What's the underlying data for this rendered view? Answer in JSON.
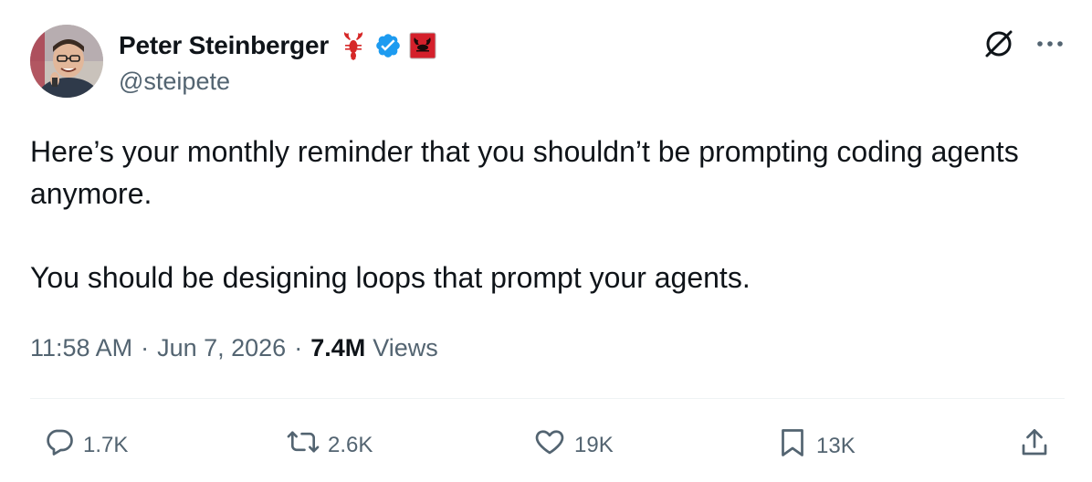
{
  "author": {
    "display_name": "Peter Steinberger",
    "handle": "@steipete"
  },
  "tweet": {
    "paragraphs": [
      "Here’s your monthly reminder that you shouldn’t be prompting coding agents anymore.",
      "You should be designing loops that prompt your agents."
    ],
    "time": "11:58 AM",
    "date": "Jun 7, 2026",
    "views_count": "7.4M",
    "views_label": "Views",
    "separator": "·"
  },
  "engagement": {
    "replies": "1.7K",
    "reposts": "2.6K",
    "likes": "19K",
    "bookmarks": "13K"
  },
  "icons": {
    "lobster": "lobster-emoji-icon",
    "verified": "verified-badge-icon",
    "affiliate": "affiliate-badge-icon",
    "grok": "grok-icon",
    "more": "more-options-icon",
    "reply": "reply-icon",
    "repost": "repost-icon",
    "like": "heart-icon",
    "bookmark": "bookmark-icon",
    "share": "share-icon"
  },
  "colors": {
    "text_primary": "#0f1419",
    "text_secondary": "#536471",
    "verified_blue": "#1d9bf0",
    "affiliate_red": "#d4202b",
    "divider": "#eff3f4"
  }
}
